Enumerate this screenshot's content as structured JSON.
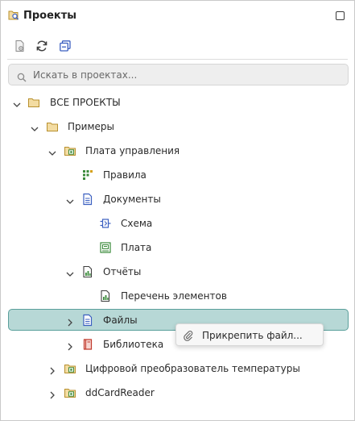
{
  "panel": {
    "title": "Проекты",
    "title_icon": "projects-search-icon"
  },
  "toolbar": {
    "buttons": [
      {
        "name": "open-project-button",
        "icon": "document-gear-icon"
      },
      {
        "name": "refresh-button",
        "icon": "refresh-icon"
      },
      {
        "name": "collapse-all-button",
        "icon": "collapse-all-icon"
      }
    ]
  },
  "search": {
    "placeholder": "Искать в проектах...",
    "value": ""
  },
  "tree": {
    "items": [
      {
        "label": "ВСЕ ПРОЕКТЫ",
        "expanded": true,
        "icon": "folder-icon"
      },
      {
        "label": "Примеры",
        "expanded": true,
        "icon": "folder-icon"
      },
      {
        "label": "Плата управления",
        "expanded": true,
        "icon": "project-icon"
      },
      {
        "label": "Правила",
        "icon": "rules-icon"
      },
      {
        "label": "Документы",
        "expanded": true,
        "icon": "document-icon"
      },
      {
        "label": "Схема",
        "icon": "schematic-icon"
      },
      {
        "label": "Плата",
        "icon": "pcb-icon"
      },
      {
        "label": "Отчёты",
        "expanded": true,
        "icon": "report-icon"
      },
      {
        "label": "Перечень элементов",
        "icon": "report-icon"
      },
      {
        "label": "Файлы",
        "expanded": false,
        "selected": true,
        "icon": "document-icon"
      },
      {
        "label": "Библиотека",
        "expanded": false,
        "icon": "library-icon"
      },
      {
        "label": "Цифровой преобразователь температуры",
        "expanded": false,
        "icon": "project-icon"
      },
      {
        "label": "ddCardReader",
        "expanded": false,
        "icon": "project-icon"
      }
    ]
  },
  "context_menu": {
    "item_label": "Прикрепить файл...",
    "icon": "paperclip-icon"
  },
  "colors": {
    "selection_bg": "#b7d8d6",
    "selection_border": "#5a9f9b",
    "folder": "#e8c37a",
    "project_green": "#3a8a3a",
    "document_blue": "#3b5fc0",
    "library_red": "#c0392b"
  }
}
